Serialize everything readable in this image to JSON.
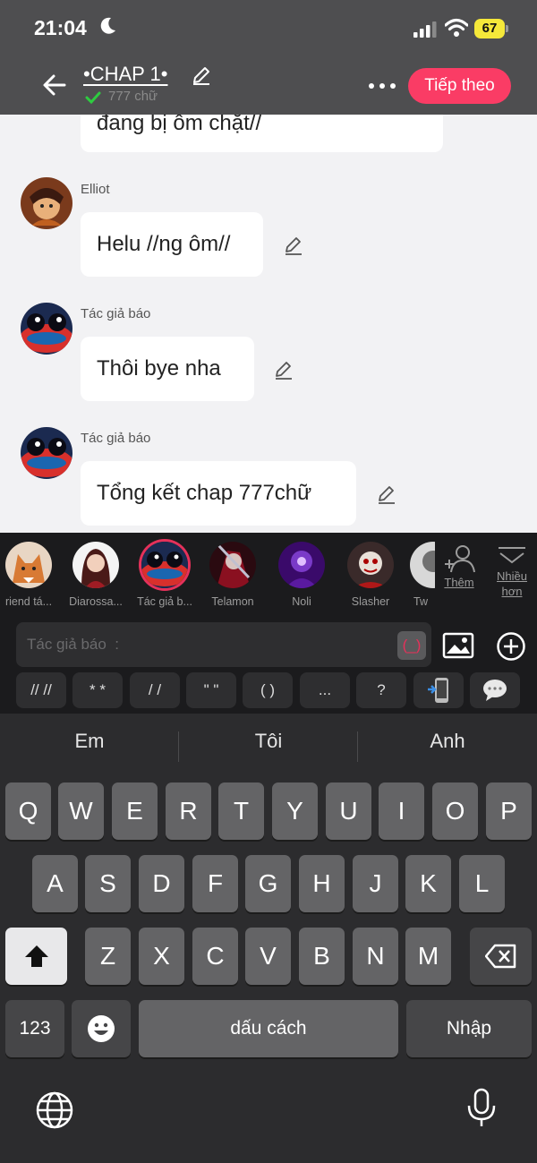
{
  "status_bar": {
    "time": "21:04",
    "battery": "67"
  },
  "header": {
    "chapter_title": "•CHAP 1•",
    "word_count": "777 chữ",
    "next_label": "Tiếp theo"
  },
  "messages": [
    {
      "sender": "",
      "text": "đang bị ôm chặt//"
    },
    {
      "sender": "Elliot",
      "text": "Helu //ng ôm//"
    },
    {
      "sender": "Tác giả báo",
      "text": "Thôi bye nha"
    },
    {
      "sender": "Tác giả báo",
      "text": "Tổng kết chap 777chữ"
    }
  ],
  "characters": [
    {
      "label": "riend tá..."
    },
    {
      "label": "Diarossa..."
    },
    {
      "label": "Tác giả b..."
    },
    {
      "label": "Telamon"
    },
    {
      "label": "Noli"
    },
    {
      "label": "Slasher"
    },
    {
      "label": "Tw"
    }
  ],
  "character_actions": {
    "add_label": "Thêm",
    "more_label": "Nhiều hơn"
  },
  "composer": {
    "placeholder": "Tác giả báo  :",
    "bracket_label": "(_)"
  },
  "quick_chips": [
    "// //",
    "* *",
    "/ /",
    "\" \"",
    "( )",
    "...",
    "?"
  ],
  "keyboard": {
    "suggestions": [
      "Em",
      "Tôi",
      "Anh"
    ],
    "row1": [
      "Q",
      "W",
      "E",
      "R",
      "T",
      "Y",
      "U",
      "I",
      "O",
      "P"
    ],
    "row2": [
      "A",
      "S",
      "D",
      "F",
      "G",
      "H",
      "J",
      "K",
      "L"
    ],
    "row3": [
      "Z",
      "X",
      "C",
      "V",
      "B",
      "N",
      "M"
    ],
    "numbers_label": "123",
    "space_label": "dấu cách",
    "return_label": "Nhập"
  },
  "colors": {
    "accent": "#fa3c65",
    "header_bg": "#4e4e50",
    "keyboard_bg": "#2c2c2e"
  }
}
